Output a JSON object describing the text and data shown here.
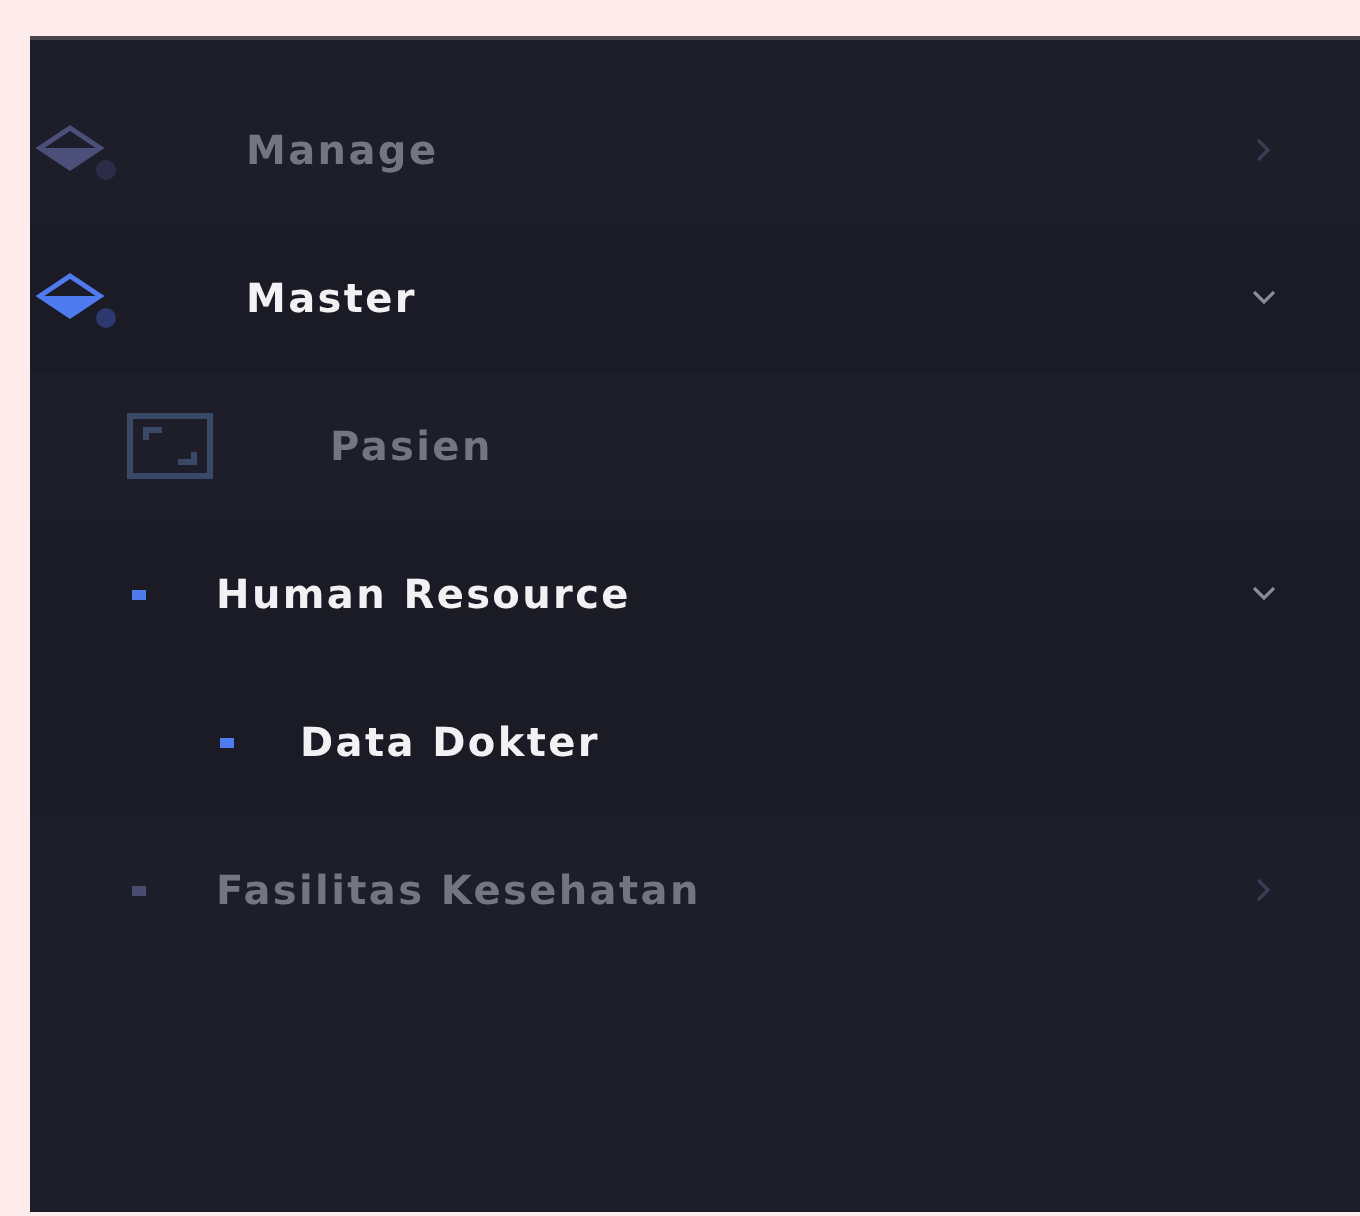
{
  "menu": [
    {
      "kind": "section",
      "label": "Manage",
      "active": false,
      "expanded": false
    },
    {
      "kind": "section",
      "label": "Master",
      "active": true,
      "expanded": true,
      "children": [
        {
          "kind": "link",
          "label": "Pasien",
          "active": false
        },
        {
          "kind": "group",
          "label": "Human Resource",
          "active": true,
          "expanded": true,
          "children": [
            {
              "kind": "bullet",
              "label": "Data Dokter",
              "active": true
            }
          ]
        },
        {
          "kind": "group",
          "label": "Fasilitas Kesehatan",
          "active": false,
          "expanded": false
        }
      ]
    }
  ]
}
